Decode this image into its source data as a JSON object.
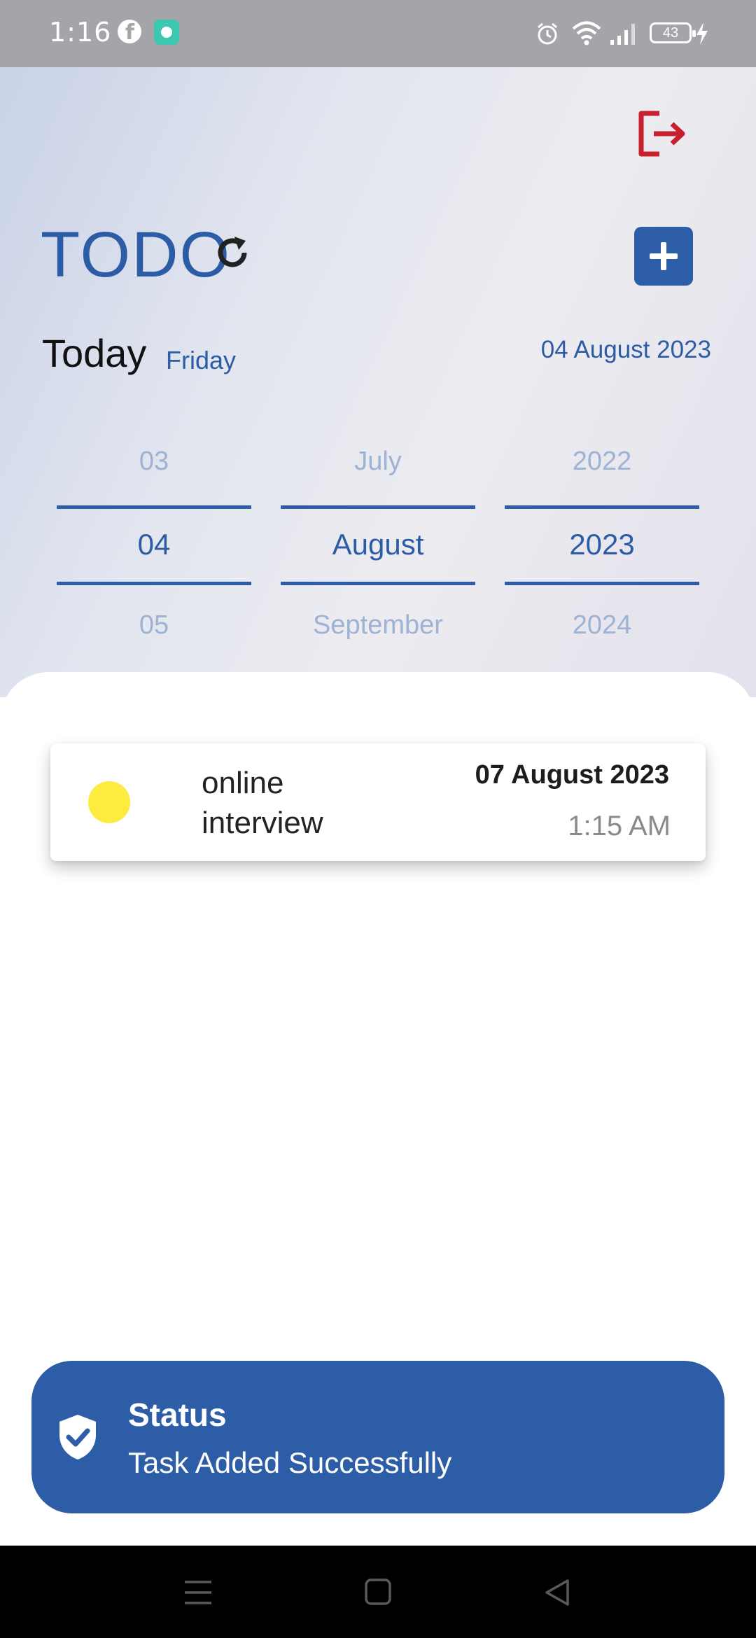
{
  "status_bar": {
    "time": "1:16",
    "battery": "43",
    "icons": [
      "facebook-icon",
      "app-notification-icon",
      "alarm-icon",
      "wifi-icon",
      "signal-icon",
      "battery-icon",
      "charging-icon"
    ]
  },
  "header": {
    "title": "TODO",
    "today_label": "Today",
    "weekday": "Friday",
    "date": "04 August 2023"
  },
  "picker": {
    "day": {
      "prev": "03",
      "selected": "04",
      "next": "05"
    },
    "month": {
      "prev": "July",
      "selected": "August",
      "next": "September"
    },
    "year": {
      "prev": "2022",
      "selected": "2023",
      "next": "2024"
    }
  },
  "tasks": [
    {
      "title": "online interview",
      "date": "07 August 2023",
      "time": "1:15 AM",
      "color": "#fdeb3f"
    }
  ],
  "toast": {
    "title": "Status",
    "message": "Task Added Successfully"
  },
  "colors": {
    "accent": "#2e5da7",
    "logout": "#c8202e",
    "task_dot": "#fdeb3f"
  }
}
